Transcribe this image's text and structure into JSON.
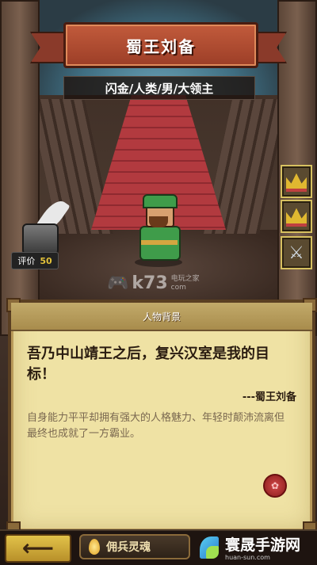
{
  "hero": {
    "name": "蜀王刘备",
    "tags": "闪金/人类/男/大领主",
    "rating_label": "评价",
    "rating_value": "50"
  },
  "panel": {
    "header": "人物背景",
    "quote": "吾乃中山靖王之后，复兴汉室是我的目标！",
    "signature": "---蜀王刘备",
    "description": "自身能力平平却拥有强大的人格魅力、年轻时颠沛流离但最终也成就了一方霸业。"
  },
  "watermark": {
    "brand": "k73",
    "line1": "电玩之家",
    "line2": "com"
  },
  "bottom": {
    "soul_button": "佣兵灵魂"
  },
  "logo": {
    "name": "寰晟手游网",
    "domain": "huan-sun.com"
  },
  "colors": {
    "parchment": "#efe2a4",
    "banner_red": "#c25b3c",
    "gold": "#e2c24a"
  }
}
